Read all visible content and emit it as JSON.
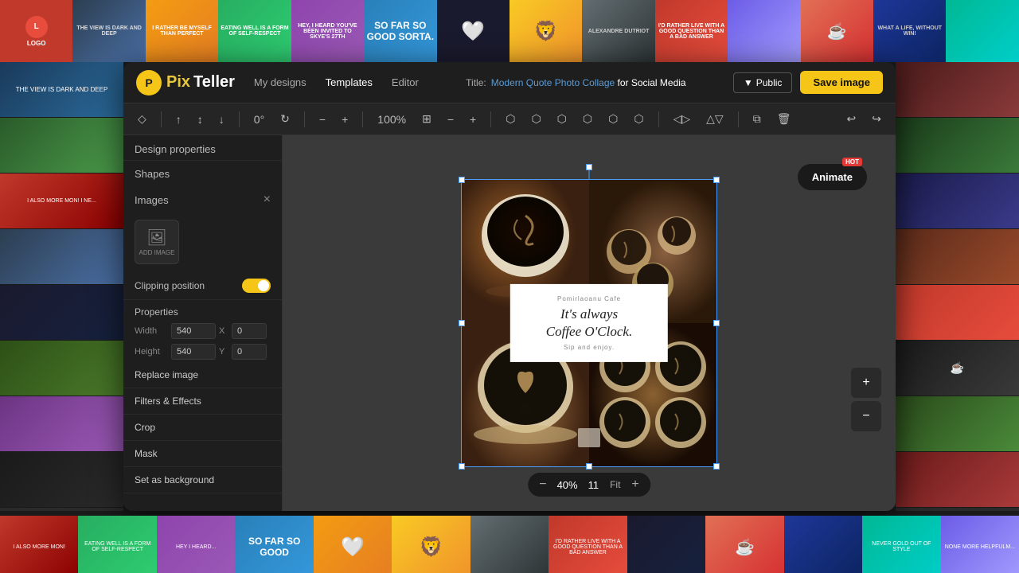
{
  "app": {
    "title": "PixTeller",
    "logo_pix": "Pix",
    "logo_teller": "Teller"
  },
  "nav": {
    "my_designs": "My designs",
    "templates": "Templates",
    "editor": "Editor"
  },
  "header": {
    "title_label": "Title:",
    "title_value": "Modern Quote Photo Collage for Social Media",
    "title_highlighted": [
      "Modern",
      "Quote",
      "Photo",
      "Collage"
    ],
    "public_label": "Public",
    "save_label": "Save image"
  },
  "toolbar": {
    "rotation": "0°",
    "zoom_percent": "100%",
    "undo_label": "↩",
    "redo_label": "↪"
  },
  "left_panel": {
    "design_properties": "Design properties",
    "shapes_label": "Shapes",
    "images_label": "Images",
    "add_image_label": "ADD IMAGE",
    "clipping_position": "Clipping position",
    "properties_label": "Properties",
    "width_label": "Width",
    "width_value": "540",
    "height_label": "Height",
    "height_value": "540",
    "x_label": "X",
    "x_value": "0",
    "y_label": "Y",
    "y_value": "0",
    "replace_image": "Replace image",
    "filters_effects": "Filters & Effects",
    "crop": "Crop",
    "mask": "Mask",
    "set_as_background": "Set as background"
  },
  "canvas": {
    "animate_label": "Animate",
    "hot_badge": "HOT",
    "coffee_subtitle": "Pomirlaoanu Cafe",
    "coffee_main_line1": "It's always",
    "coffee_main_line2": "Coffee O'Clock.",
    "coffee_tagline": "Sip and enjoy."
  },
  "zoom_bar": {
    "minus": "−",
    "plus": "+",
    "value": "40%",
    "number": "11",
    "fit": "Fit"
  },
  "strip_items": [
    {
      "color_class": "s1",
      "text": "LOGO"
    },
    {
      "color_class": "s2",
      "text": ""
    },
    {
      "color_class": "s3",
      "text": ""
    },
    {
      "color_class": "s4",
      "text": ""
    },
    {
      "color_class": "s5",
      "text": ""
    },
    {
      "color_class": "s6",
      "text": ""
    },
    {
      "color_class": "s7",
      "text": ""
    },
    {
      "color_class": "s8",
      "text": ""
    },
    {
      "color_class": "s9",
      "text": ""
    },
    {
      "color_class": "s10",
      "text": ""
    },
    {
      "color_class": "s11",
      "text": ""
    },
    {
      "color_class": "s12",
      "text": ""
    },
    {
      "color_class": "s13",
      "text": ""
    },
    {
      "color_class": "s14",
      "text": ""
    },
    {
      "color_class": "s15",
      "text": ""
    },
    {
      "color_class": "s16",
      "text": ""
    }
  ]
}
